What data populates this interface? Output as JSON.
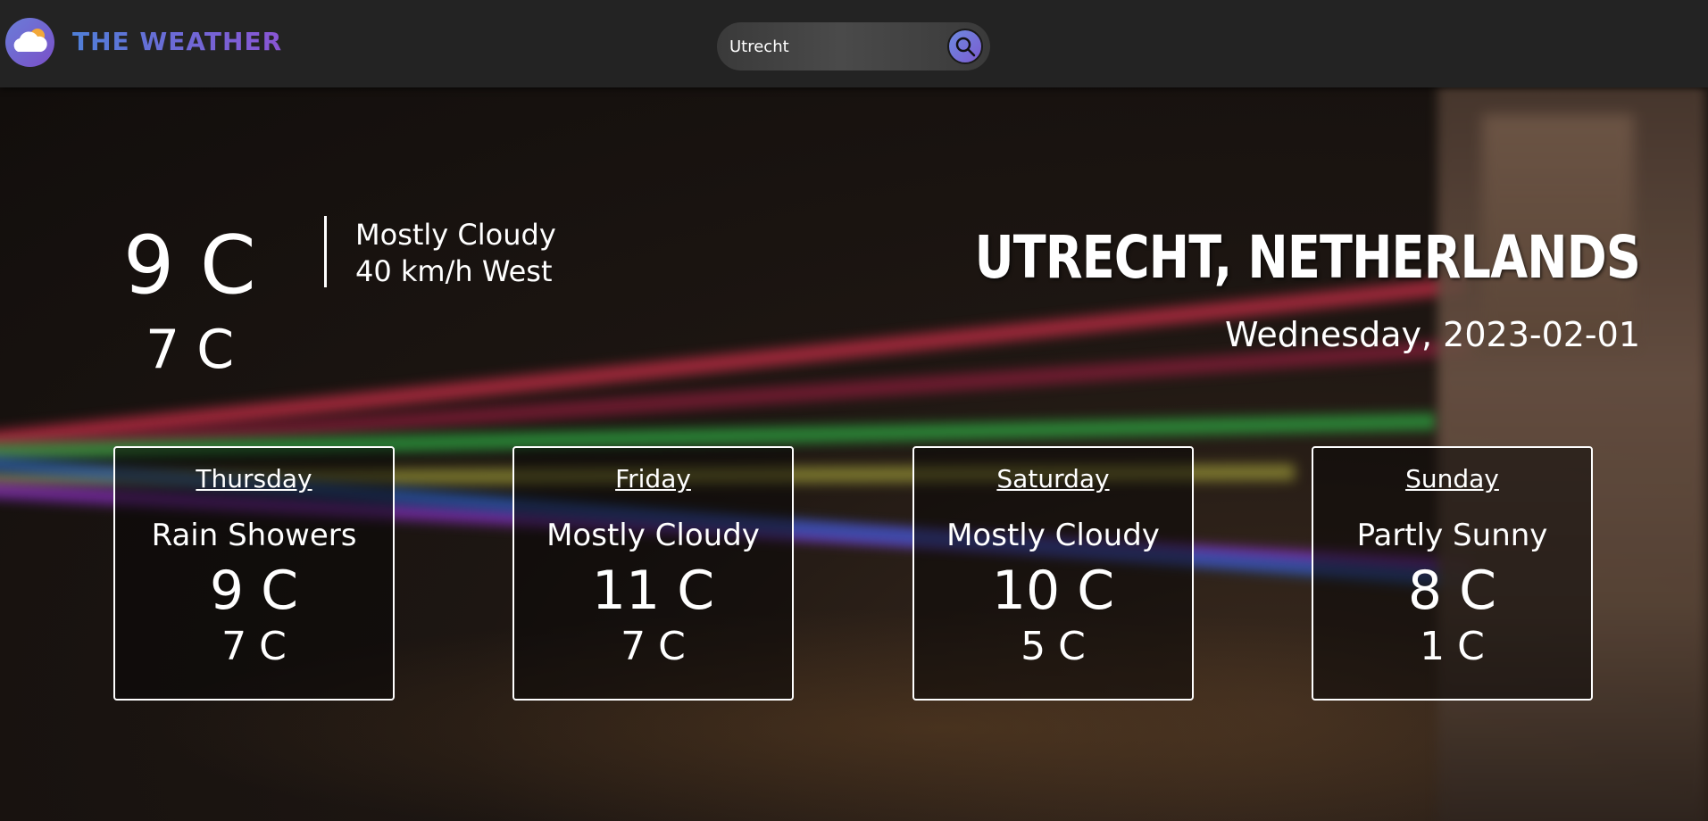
{
  "brand": "THE WEATHER",
  "search": {
    "value": "Utrecht",
    "placeholder": ""
  },
  "current": {
    "high": "9 C",
    "low": "7 C",
    "condition": "Mostly Cloudy",
    "wind": "40 km/h West",
    "location": "UTRECHT, NETHERLANDS",
    "date": "Wednesday, 2023-02-01"
  },
  "forecast": [
    {
      "day": "Thursday",
      "condition": "Rain Showers",
      "high": "9 C",
      "low": "7 C"
    },
    {
      "day": "Friday",
      "condition": "Mostly Cloudy",
      "high": "11 C",
      "low": "7 C"
    },
    {
      "day": "Saturday",
      "condition": "Mostly Cloudy",
      "high": "10 C",
      "low": "5 C"
    },
    {
      "day": "Sunday",
      "condition": "Partly Sunny",
      "high": "8 C",
      "low": "1 C"
    }
  ],
  "colors": {
    "accent": "#6d7fdc",
    "header_bg": "#232323"
  },
  "icons": {
    "logo": "cloud-sun-icon",
    "search": "search-icon"
  }
}
